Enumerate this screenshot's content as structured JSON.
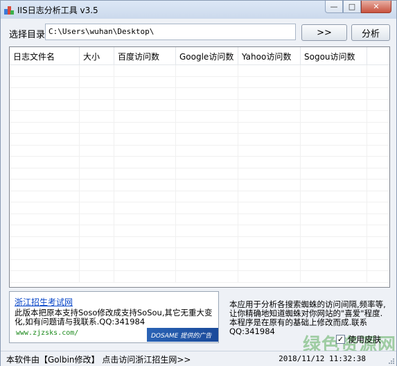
{
  "window": {
    "title": "IIS日志分析工具 v3.5",
    "icon": "app-icon",
    "minimize_glyph": "—",
    "maximize_glyph": "□",
    "close_glyph": "✕"
  },
  "directory": {
    "label": "选择目录",
    "value": "C:\\Users\\wuhan\\Desktop\\",
    "browse_label": ">>",
    "analyze_label": "分析"
  },
  "table": {
    "columns": [
      "日志文件名",
      "大小",
      "百度访问数",
      "Google访问数",
      "Yahoo访问数",
      "Sogou访问数"
    ],
    "rows": []
  },
  "ad": {
    "link": "浙江招生考试网",
    "text": "此版本把原本支持Soso修改成支持SoSou,其它无重大变化,如有问题请与我联系.QQ:341984",
    "url": "www.zjzsks.com/",
    "banner": "DOSAME  提供的广告"
  },
  "description": "本应用于分析各搜索蜘蛛的访问间隔,频率等,让你精确地知道蜘蛛对你网站的\"喜爱\"程度.本程序是在原有的基础上修改而成.联系QQ:341984",
  "skin": {
    "label": "使用皮肤",
    "checked": true,
    "check_glyph": "✓"
  },
  "status": {
    "author_text": "本软件由【Golbin修改】",
    "visit_link": "点击访问浙江招生网>>",
    "datetime": "2018/11/12 11:32:38"
  },
  "watermark": "绿色资源网",
  "colors": {
    "link": "#0645c8",
    "url_green": "#1c8a1c",
    "close_red": "#c8523e"
  }
}
